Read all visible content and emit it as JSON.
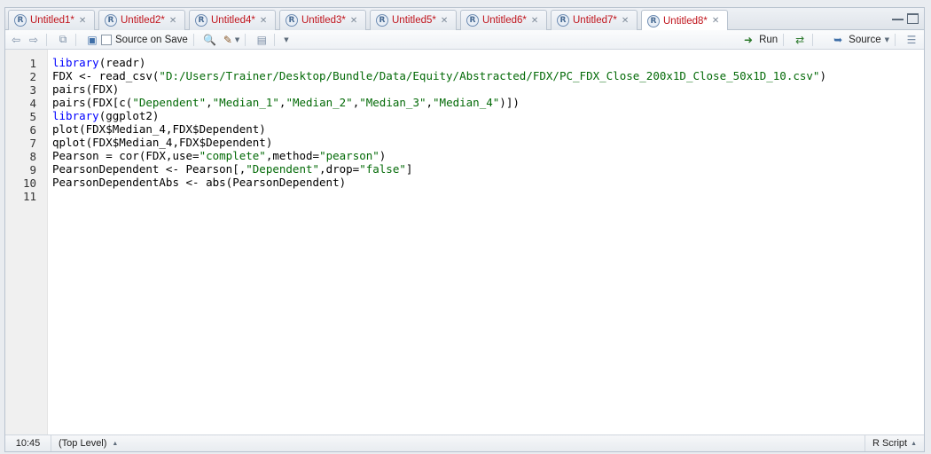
{
  "tabs": [
    {
      "label": "Untitled1*"
    },
    {
      "label": "Untitled2*"
    },
    {
      "label": "Untitled4*"
    },
    {
      "label": "Untitled3*"
    },
    {
      "label": "Untitled5*"
    },
    {
      "label": "Untitled6*"
    },
    {
      "label": "Untitled7*"
    },
    {
      "label": "Untitled8*",
      "active": true
    }
  ],
  "toolbar": {
    "source_on_save": "Source on Save",
    "run": "Run",
    "source": "Source"
  },
  "editor": {
    "line_numbers": [
      "1",
      "2",
      "3",
      "4",
      "5",
      "6",
      "7",
      "8",
      "9",
      "10",
      "11"
    ],
    "lines": [
      [
        {
          "t": "library",
          "k": "kw"
        },
        {
          "t": "(readr)"
        }
      ],
      [
        {
          "t": "FDX <- read_csv("
        },
        {
          "t": "\"D:/Users/Trainer/Desktop/Bundle/Data/Equity/Abstracted/FDX/PC_FDX_Close_200x1D_Close_50x1D_10.csv\"",
          "k": "str"
        },
        {
          "t": ")"
        }
      ],
      [
        {
          "t": "pairs(FDX)"
        }
      ],
      [
        {
          "t": "pairs(FDX[c("
        },
        {
          "t": "\"Dependent\"",
          "k": "str"
        },
        {
          "t": ","
        },
        {
          "t": "\"Median_1\"",
          "k": "str"
        },
        {
          "t": ","
        },
        {
          "t": "\"Median_2\"",
          "k": "str"
        },
        {
          "t": ","
        },
        {
          "t": "\"Median_3\"",
          "k": "str"
        },
        {
          "t": ","
        },
        {
          "t": "\"Median_4\"",
          "k": "str"
        },
        {
          "t": ")])"
        }
      ],
      [
        {
          "t": "library",
          "k": "kw"
        },
        {
          "t": "(ggplot2)"
        }
      ],
      [
        {
          "t": "plot(FDX$Median_4,FDX$Dependent)"
        }
      ],
      [
        {
          "t": "qplot(FDX$Median_4,FDX$Dependent)"
        }
      ],
      [
        {
          "t": "Pearson = cor(FDX,use="
        },
        {
          "t": "\"complete\"",
          "k": "str"
        },
        {
          "t": ",method="
        },
        {
          "t": "\"pearson\"",
          "k": "str"
        },
        {
          "t": ")"
        }
      ],
      [
        {
          "t": "PearsonDependent <- Pearson[,"
        },
        {
          "t": "\"Dependent\"",
          "k": "str"
        },
        {
          "t": ",drop="
        },
        {
          "t": "\"false\"",
          "k": "str"
        },
        {
          "t": "]"
        }
      ],
      [
        {
          "t": "PearsonDependentAbs <- abs(PearsonDependent)"
        }
      ],
      []
    ]
  },
  "status": {
    "cursor": "10:45",
    "scope": "(Top Level)",
    "file_type": "R Script"
  }
}
